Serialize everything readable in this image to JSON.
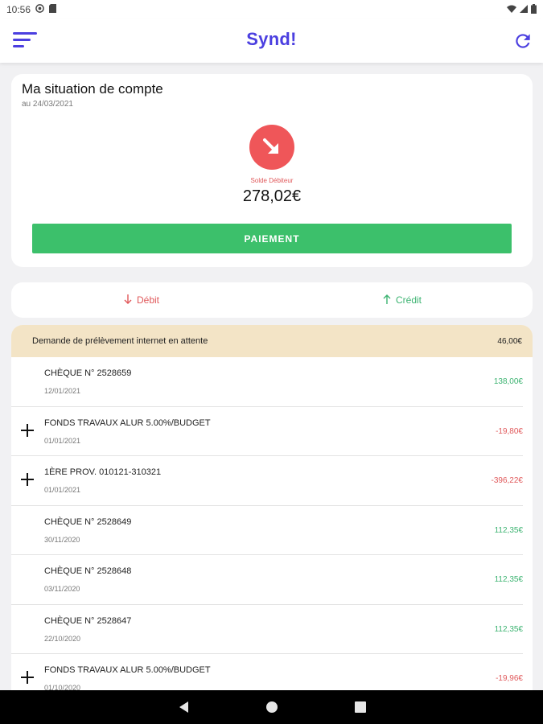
{
  "status_bar": {
    "time": "10:56",
    "left_icons": [
      "at-sign-icon",
      "sd-card-icon"
    ],
    "right_icons": [
      "wifi-icon",
      "signal-icon",
      "battery-icon"
    ]
  },
  "app_bar": {
    "title": "Synd!",
    "accent_color": "#4b3fe0",
    "menu_icon": "menu-icon",
    "refresh_icon": "refresh-icon"
  },
  "account": {
    "title": "Ma situation de compte",
    "date": "au 24/03/2021",
    "balance_icon": "arrow-down-right-icon",
    "balance_label": "Solde Débiteur",
    "balance_amount": "278,02€",
    "pay_button": "PAIEMENT",
    "colors": {
      "debit": "#ef5659",
      "pay_button": "#3cc06b"
    }
  },
  "tabs": [
    {
      "label": "Débit",
      "icon": "arrow-down-icon"
    },
    {
      "label": "Crédit",
      "icon": "arrow-up-icon"
    }
  ],
  "pending": {
    "label": "Demande de prélèvement internet en attente",
    "amount": "46,00€",
    "background": "#f3e4c6"
  },
  "transactions": [
    {
      "label": "CHÈQUE N° 2528659",
      "date": "12/01/2021",
      "amount": "138,00€",
      "kind": "credit",
      "expandable": false
    },
    {
      "label": "FONDS TRAVAUX ALUR 5.00%/BUDGET",
      "date": "01/01/2021",
      "amount": "-19,80€",
      "kind": "debit",
      "expandable": true
    },
    {
      "label": "1ÈRE PROV. 010121-310321",
      "date": "01/01/2021",
      "amount": "-396,22€",
      "kind": "debit",
      "expandable": true
    },
    {
      "label": "CHÈQUE N° 2528649",
      "date": "30/11/2020",
      "amount": "112,35€",
      "kind": "credit",
      "expandable": false
    },
    {
      "label": "CHÈQUE N° 2528648",
      "date": "03/11/2020",
      "amount": "112,35€",
      "kind": "credit",
      "expandable": false
    },
    {
      "label": "CHÈQUE N° 2528647",
      "date": "22/10/2020",
      "amount": "112,35€",
      "kind": "credit",
      "expandable": false
    },
    {
      "label": "FONDS TRAVAUX ALUR 5.00%/BUDGET",
      "date": "01/10/2020",
      "amount": "-19,96€",
      "kind": "debit",
      "expandable": true
    }
  ],
  "nav_bar": [
    "back-icon",
    "home-icon",
    "recents-icon"
  ]
}
